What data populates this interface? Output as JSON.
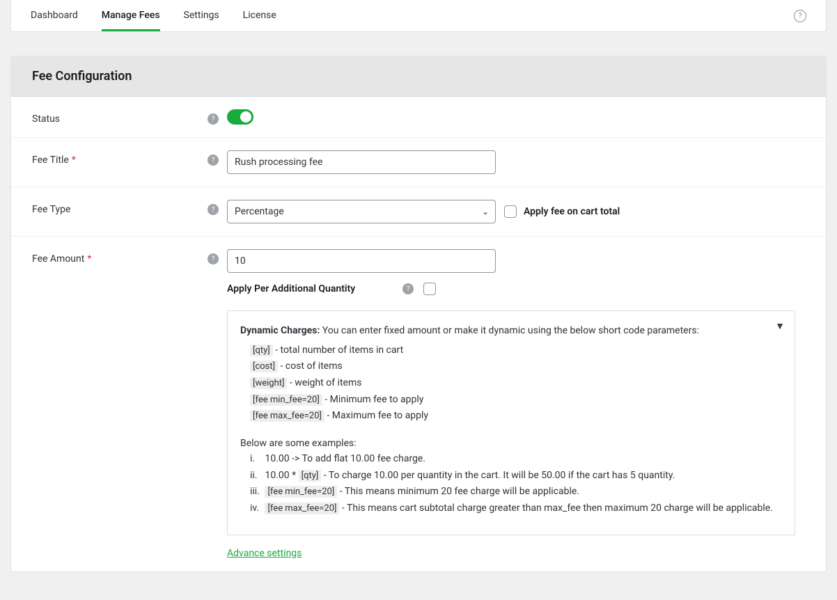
{
  "tabs": {
    "dashboard": "Dashboard",
    "manage": "Manage Fees",
    "settings": "Settings",
    "license": "License"
  },
  "section": {
    "title": "Fee Configuration"
  },
  "status": {
    "label": "Status",
    "enabled": true
  },
  "feeTitle": {
    "label": "Fee Title",
    "value": "Rush processing fee"
  },
  "feeType": {
    "label": "Fee Type",
    "selected": "Percentage",
    "applyOnCartTotal": "Apply fee on cart total"
  },
  "feeAmount": {
    "label": "Fee Amount",
    "value": "10",
    "apqLabel": "Apply Per Additional Quantity"
  },
  "dynamic": {
    "title": "Dynamic Charges:",
    "intro": " You can enter fixed amount or make it dynamic using the below short code parameters:",
    "sc": {
      "qty": {
        "code": "[qty]",
        "desc": " - total number of items in cart"
      },
      "cost": {
        "code": "[cost]",
        "desc": " - cost of items"
      },
      "weight": {
        "code": "[weight]",
        "desc": " - weight of items"
      },
      "min": {
        "code": "[fee min_fee=20]",
        "desc": " - Minimum fee to apply"
      },
      "max": {
        "code": "[fee max_fee=20]",
        "desc": " - Maximum fee to apply"
      }
    },
    "examplesLead": "Below are some examples:",
    "ex": {
      "e1": {
        "num": "i.",
        "pre": " 10.00 -> To add flat 10.00 fee charge."
      },
      "e2": {
        "num": "ii.",
        "pre": " 10.00 * ",
        "code": "[qty]",
        "post": " - To charge 10.00 per quantity in the cart. It will be 50.00 if the cart has 5 quantity."
      },
      "e3": {
        "num": "iii.",
        "code": "[fee min_fee=20]",
        "post": " - This means minimum 20 fee charge will be applicable."
      },
      "e4": {
        "num": "iv.",
        "code": "[fee max_fee=20]",
        "post": " - This means cart subtotal charge greater than max_fee then maximum 20 charge will be applicable."
      }
    }
  },
  "advanceLink": "Advance settings"
}
